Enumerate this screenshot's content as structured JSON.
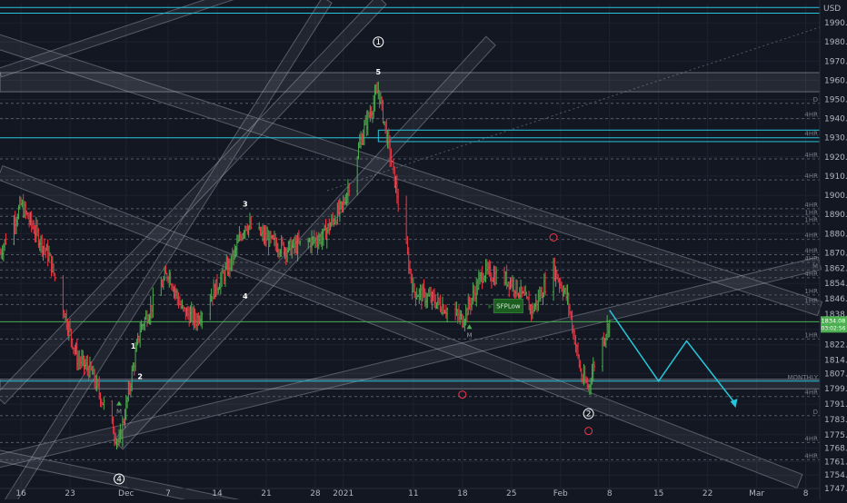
{
  "currency": "USD",
  "price_tag": {
    "price": "1834.08",
    "countdown": "03:02:56"
  },
  "chart_data": {
    "type": "candlestick",
    "title": "",
    "xlabel": "",
    "ylabel": "",
    "ylim": [
      1747,
      2000
    ],
    "x_range": [
      "2020-11-13",
      "2021-03-10"
    ],
    "grid": true,
    "colors": {
      "up": "#4caf50",
      "down": "#f23645",
      "background": "#131722",
      "projection": "#26c6da"
    },
    "y_ticks": [
      1747.0,
      1754.0,
      1761.0,
      1768.0,
      1775.0,
      1783.0,
      1791.0,
      1799.0,
      1807.0,
      1814.0,
      1822.0,
      1830.0,
      1838.0,
      1846.0,
      1854.0,
      1862.0,
      1870.0,
      1880.0,
      1890.0,
      1900.0,
      1910.0,
      1920.0,
      1930.0,
      1940.0,
      1950.0,
      1960.0,
      1970.0,
      1980.0,
      1990.0
    ],
    "x_ticks": [
      {
        "label": "16",
        "date": "2020-11-16"
      },
      {
        "label": "23",
        "date": "2020-11-23"
      },
      {
        "label": "Dec",
        "date": "2020-12-01"
      },
      {
        "label": "7",
        "date": "2020-12-07"
      },
      {
        "label": "14",
        "date": "2020-12-14"
      },
      {
        "label": "21",
        "date": "2020-12-21"
      },
      {
        "label": "28",
        "date": "2020-12-28"
      },
      {
        "label": "2021",
        "date": "2021-01-01"
      },
      {
        "label": "11",
        "date": "2021-01-11"
      },
      {
        "label": "18",
        "date": "2021-01-18"
      },
      {
        "label": "25",
        "date": "2021-01-25"
      },
      {
        "label": "Feb",
        "date": "2021-02-01"
      },
      {
        "label": "8",
        "date": "2021-02-08"
      },
      {
        "label": "15",
        "date": "2021-02-15"
      },
      {
        "label": "22",
        "date": "2021-02-22"
      },
      {
        "label": "Mar",
        "date": "2021-03-01"
      },
      {
        "label": "8",
        "date": "2021-03-08"
      }
    ],
    "price_path": [
      {
        "date": "2020-11-13",
        "price": 1870
      },
      {
        "date": "2020-11-16",
        "price": 1895
      },
      {
        "date": "2020-11-20",
        "price": 1868
      },
      {
        "date": "2020-11-24",
        "price": 1815
      },
      {
        "date": "2020-11-26",
        "price": 1808
      },
      {
        "date": "2020-11-30",
        "price": 1770
      },
      {
        "date": "2020-12-03",
        "price": 1830
      },
      {
        "date": "2020-12-07",
        "price": 1860
      },
      {
        "date": "2020-12-09",
        "price": 1840
      },
      {
        "date": "2020-12-11",
        "price": 1835
      },
      {
        "date": "2020-12-16",
        "price": 1865
      },
      {
        "date": "2020-12-18",
        "price": 1885
      },
      {
        "date": "2020-12-22",
        "price": 1875
      },
      {
        "date": "2020-12-24",
        "price": 1872
      },
      {
        "date": "2020-12-29",
        "price": 1878
      },
      {
        "date": "2021-01-01",
        "price": 1895
      },
      {
        "date": "2021-01-04",
        "price": 1935
      },
      {
        "date": "2021-01-06",
        "price": 1955
      },
      {
        "date": "2021-01-08",
        "price": 1915
      },
      {
        "date": "2021-01-11",
        "price": 1850
      },
      {
        "date": "2021-01-14",
        "price": 1845
      },
      {
        "date": "2021-01-18",
        "price": 1835
      },
      {
        "date": "2021-01-21",
        "price": 1860
      },
      {
        "date": "2021-01-25",
        "price": 1855
      },
      {
        "date": "2021-01-28",
        "price": 1840
      },
      {
        "date": "2021-01-31",
        "price": 1862
      },
      {
        "date": "2021-02-02",
        "price": 1846
      },
      {
        "date": "2021-02-04",
        "price": 1805
      },
      {
        "date": "2021-02-05",
        "price": 1800
      },
      {
        "date": "2021-02-06",
        "price": 1815
      },
      {
        "date": "2021-02-08",
        "price": 1834
      }
    ],
    "projection": [
      {
        "date": "2021-02-08",
        "price": 1840
      },
      {
        "date": "2021-02-15",
        "price": 1803
      },
      {
        "date": "2021-02-19",
        "price": 1824
      },
      {
        "date": "2021-02-26",
        "price": 1791
      }
    ],
    "horizontal_levels": [
      {
        "price": 1998,
        "label": "",
        "color": "#26c6da"
      },
      {
        "price": 1995,
        "label": "",
        "color": "#26c6da"
      },
      {
        "price": 1948,
        "label": "D",
        "color": "#555a66"
      },
      {
        "price": 1940,
        "label": "4HR",
        "color": "#555a66"
      },
      {
        "price": 1930,
        "label": "4HR",
        "color": "#26c6da"
      },
      {
        "price": 1919,
        "label": "4HR",
        "color": "#555a66"
      },
      {
        "price": 1908,
        "label": "4HR",
        "color": "#555a66"
      },
      {
        "price": 1893,
        "label": "4HR",
        "color": "#555a66"
      },
      {
        "price": 1889,
        "label": "1HR",
        "color": "#555a66"
      },
      {
        "price": 1885,
        "label": "1HR",
        "color": "#555a66"
      },
      {
        "price": 1877,
        "label": "4HR",
        "color": "#555a66"
      },
      {
        "price": 1869,
        "label": "4HR",
        "color": "#555a66"
      },
      {
        "price": 1865,
        "label": "4HR",
        "color": "#555a66"
      },
      {
        "price": 1861,
        "label": "M",
        "color": "#555a66"
      },
      {
        "price": 1857,
        "label": "4HR",
        "color": "#555a66"
      },
      {
        "price": 1848,
        "label": "1HR",
        "color": "#555a66"
      },
      {
        "price": 1843,
        "label": "1HR",
        "color": "#555a66"
      },
      {
        "price": 1834,
        "label": "",
        "color": "#4caf50"
      },
      {
        "price": 1825,
        "label": "1HR",
        "color": "#555a66"
      },
      {
        "price": 1803,
        "label": "MONTHLY",
        "color": "#26c6da"
      },
      {
        "price": 1795,
        "label": "4HR",
        "color": "#555a66"
      },
      {
        "price": 1785,
        "label": "D",
        "color": "#555a66"
      },
      {
        "price": 1771,
        "label": "4HR",
        "color": "#555a66"
      },
      {
        "price": 1762,
        "label": "4HR",
        "color": "#555a66"
      }
    ],
    "zones": [
      {
        "price_from": 1954,
        "price_to": 1964
      },
      {
        "price_from": 1799,
        "price_to": 1804
      }
    ],
    "zone_teal": {
      "date_from": "2021-01-06",
      "date_to": "2021-03-13",
      "price_from": 1928,
      "price_to": 1934
    },
    "wave_labels": [
      {
        "text": "1",
        "date": "2021-01-06",
        "price": 1980,
        "style": "circle"
      },
      {
        "text": "5",
        "date": "2021-01-06",
        "price": 1963,
        "style": "plain"
      },
      {
        "text": "3",
        "date": "2020-12-18",
        "price": 1894,
        "style": "plain"
      },
      {
        "text": "4",
        "date": "2020-12-18",
        "price": 1846,
        "style": "plain"
      },
      {
        "text": "1",
        "date": "2020-12-02",
        "price": 1820,
        "style": "plain"
      },
      {
        "text": "2",
        "date": "2020-12-03",
        "price": 1804,
        "style": "plain"
      },
      {
        "text": "4",
        "date": "2020-11-30",
        "price": 1752,
        "style": "circle"
      },
      {
        "text": "2",
        "date": "2021-02-05",
        "price": 1786,
        "style": "circle"
      }
    ],
    "red_markers": [
      {
        "date": "2021-01-31",
        "price": 1878
      },
      {
        "date": "2021-01-18",
        "price": 1796
      },
      {
        "date": "2021-02-05",
        "price": 1777
      }
    ],
    "signal_labels": [
      {
        "text": "SFPLow",
        "date": "2021-01-23",
        "price": 1842
      }
    ],
    "small_markers": [
      {
        "text": "M",
        "date": "2021-01-19",
        "price": 1826
      },
      {
        "text": "M",
        "date": "2020-11-30",
        "price": 1786
      }
    ]
  }
}
